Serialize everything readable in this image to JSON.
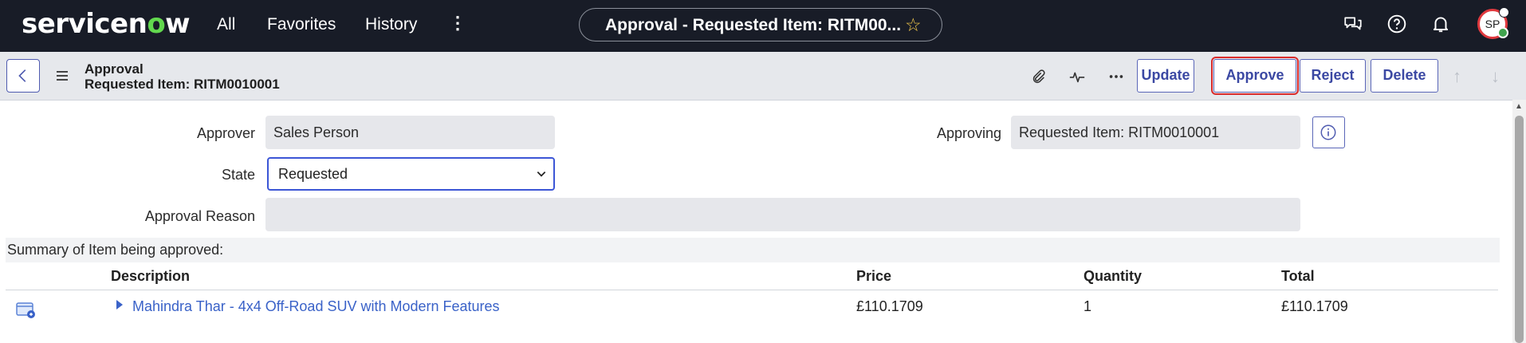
{
  "nav": {
    "logo_pre": "servicen",
    "logo_o": "o",
    "logo_post": "w",
    "links": [
      "All",
      "Favorites",
      "History"
    ],
    "more": "⋮",
    "title": "Approval - Requested Item: RITM00...",
    "avatar_initials": "SP"
  },
  "header": {
    "title_line1": "Approval",
    "title_line2": "Requested Item: RITM0010001",
    "buttons": {
      "update": "Update",
      "approve": "Approve",
      "reject": "Reject",
      "delete": "Delete"
    }
  },
  "form": {
    "approver_label": "Approver",
    "approver_value": "Sales Person",
    "state_label": "State",
    "state_value": "Requested",
    "approval_reason_label": "Approval Reason",
    "approval_reason_value": "",
    "approving_label": "Approving",
    "approving_value": "Requested Item: RITM0010001"
  },
  "summary": {
    "heading": "Summary of Item being approved:",
    "columns": [
      "Description",
      "Price",
      "Quantity",
      "Total"
    ],
    "rows": [
      {
        "description": "Mahindra Thar - 4x4 Off-Road SUV with Modern Features",
        "price": "£110.1709",
        "quantity": "1",
        "total": "£110.1709"
      }
    ]
  },
  "colors": {
    "nav_bg": "#181c27",
    "accent": "#3b48a3",
    "highlight": "#d92b2b",
    "link": "#3a62c8"
  }
}
